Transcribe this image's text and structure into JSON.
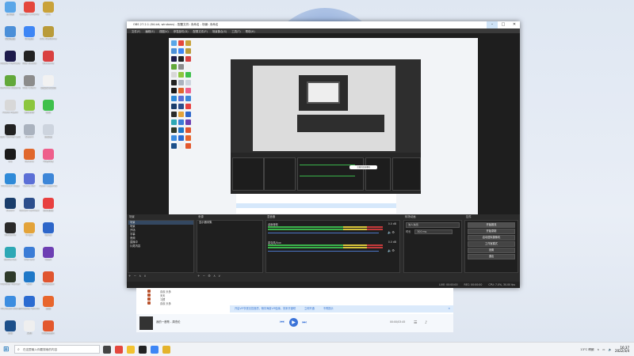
{
  "desktop": {
    "icons": [
      {
        "label": "此电脑",
        "color": "#5aa6e8"
      },
      {
        "label": "Google Chrome",
        "color": "#e4473d"
      },
      {
        "label": "LOL",
        "color": "#c9a23a"
      },
      {
        "label": "控制面板",
        "color": "#4b8fd8"
      },
      {
        "label": "QQ音乐",
        "color": "#3e86f5"
      },
      {
        "label": "LOL WeGame",
        "color": "#b99b3a"
      },
      {
        "label": "Adobe Premiere",
        "color": "#1d1b4b"
      },
      {
        "label": "OBS Studio",
        "color": "#222222"
      },
      {
        "label": "WeGame",
        "color": "#d94040"
      },
      {
        "label": "GeForce Experience",
        "color": "#62a83a"
      },
      {
        "label": "Riot Client",
        "color": "#8c8c8c"
      },
      {
        "label": "新建文本文档",
        "color": "#f2f2f2"
      },
      {
        "label": "Audio Hijack",
        "color": "#d8d8d8"
      },
      {
        "label": "我的世界",
        "color": "#8cc63e"
      },
      {
        "label": "微信",
        "color": "#3ec04b"
      },
      {
        "label": "Epic Games Launcher",
        "color": "#222222"
      },
      {
        "label": "Steam",
        "color": "#aab2be"
      },
      {
        "label": "回收站",
        "color": "#cdd4de"
      },
      {
        "label": "QQ",
        "color": "#1a1a1a"
      },
      {
        "label": "Garena",
        "color": "#e0682d"
      },
      {
        "label": "哔哩哔哩",
        "color": "#ee5f8c"
      },
      {
        "label": "Microsoft Edge",
        "color": "#2f8ad8"
      },
      {
        "label": "Game Bar",
        "color": "#5b6fd6"
      },
      {
        "label": "Apex Legends",
        "color": "#3d86d8"
      },
      {
        "label": "Steam",
        "color": "#1a3d6b"
      },
      {
        "label": "Ubisoft Connect",
        "color": "#2c4e8c"
      },
      {
        "label": "腾讯视频",
        "color": "#e84040"
      },
      {
        "label": "WeGame",
        "color": "#2a2a2a"
      },
      {
        "label": "Origin",
        "color": "#e3a33a"
      },
      {
        "label": "Uplay",
        "color": "#2d66c9"
      },
      {
        "label": "Battle.net",
        "color": "#2da8b5"
      },
      {
        "label": "uTorrent",
        "color": "#3b7cd6"
      },
      {
        "label": "Geek",
        "color": "#6d3fb3"
      },
      {
        "label": "Monster Hunter",
        "color": "#2e3a2a"
      },
      {
        "label": "Kodi",
        "color": "#1f78c8"
      },
      {
        "label": "Wallpaper",
        "color": "#e0552f"
      },
      {
        "label": "Microsoft Store",
        "color": "#3c8de0"
      },
      {
        "label": "Windows Terminal",
        "color": "#2b6bd1"
      },
      {
        "label": "迅雷",
        "color": "#e8662d"
      },
      {
        "label": "设置",
        "color": "#1c4f8a"
      },
      {
        "label": "文档",
        "color": "#efefef"
      },
      {
        "label": "网易云音乐",
        "color": "#e3582d"
      }
    ]
  },
  "obs": {
    "title": "OBS 27.2.1 (64-bit, windows) - 配置文件: 未命名 - 场景: 未命名",
    "window_controls": {
      "minimize": "–",
      "maximize": "□",
      "close": "✕"
    },
    "menu": [
      "文件(F)",
      "编辑(E)",
      "视图(V)",
      "停靠部件(D)",
      "配置文件(P)",
      "场景集合(S)",
      "工具(T)",
      "帮助(H)"
    ],
    "nested": {
      "bubble": "主播开始直播啦"
    },
    "docks": {
      "scenes": {
        "title": "场景",
        "items": [
          "场景",
          "场景",
          "开场",
          "字幕",
          "音频",
          "直播中",
          "片尾内容"
        ],
        "footer": "+ − ∧ ∨"
      },
      "sources": {
        "title": "来源",
        "items": [
          "显示器采集"
        ],
        "footer": "+ − ⚙ ∧ ∨"
      },
      "mixer": {
        "title": "混音器",
        "channels": [
          {
            "name": "桌面音频",
            "db": "0.0 dB"
          },
          {
            "name": "麦克风/Aux",
            "db": "0.0 dB"
          }
        ]
      },
      "transitions": {
        "title": "转场动画",
        "type": "淡入淡出",
        "duration_label": "时长",
        "duration": "300 ms"
      },
      "controls": {
        "title": "控件",
        "buttons": [
          "开始推流",
          "开始录制",
          "启动虚拟摄像机",
          "工作室模式",
          "设置",
          "退出"
        ]
      }
    },
    "status": [
      "LIVE: 00:00:00",
      "REC: 00:00:00",
      "CPU: 7.0%, 30.00 fps"
    ]
  },
  "music": {
    "songs": [
      {
        "title": "喜欢 乐多",
        "artist": "",
        "album": "",
        "duration": ""
      },
      {
        "title": "天天",
        "artist": "",
        "album": "",
        "duration": ""
      },
      {
        "title": "习惯",
        "artist": "",
        "album": "",
        "duration": ""
      },
      {
        "title": "喜欢 乐多",
        "artist": "",
        "album": "",
        "duration": ""
      }
    ],
    "notice": "开启VIP享受无损音质，畅享海量VIP曲库，快来开通吧",
    "notice_link": "立即开通",
    "notice_link2": "不再提示",
    "now_playing": "我的一首歌 - 周杰伦",
    "time": "00:00/03:45"
  },
  "taskbar": {
    "search_placeholder": "在这里输入你要搜索的内容",
    "apps": [
      {
        "name": "task-view",
        "color": "#444"
      },
      {
        "name": "chrome",
        "color": "#e4473d"
      },
      {
        "name": "file-explorer",
        "color": "#f2c230"
      },
      {
        "name": "obs",
        "color": "#222"
      },
      {
        "name": "qq-music",
        "color": "#3e86f5"
      },
      {
        "name": "folder",
        "color": "#e4b32c"
      }
    ],
    "weather": "13°C 晴朗",
    "time": "16:37",
    "date": "2022/3/4"
  }
}
